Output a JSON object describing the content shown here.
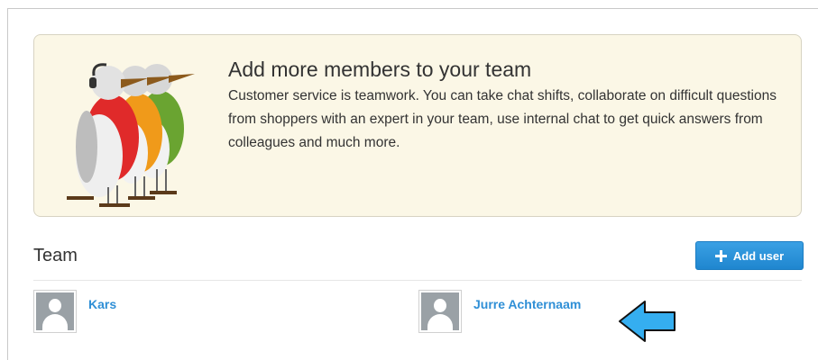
{
  "banner": {
    "title": "Add more members to your team",
    "text": "Customer service is teamwork. You can take chat shifts, collaborate on difficult questions from shoppers with an expert in your team, use internal chat to get quick answers from colleagues and much more."
  },
  "team": {
    "title": "Team",
    "add_button_label": "Add user",
    "members": [
      {
        "name": "Kars"
      },
      {
        "name": "Jurre Achternaam"
      }
    ]
  },
  "colors": {
    "accent": "#1f86cf",
    "banner_bg": "#fbf7e6",
    "link": "#2f8fd6",
    "arrow": "#35aef0"
  },
  "icons": [
    "birds-illustration",
    "plus-icon",
    "avatar-placeholder-icon",
    "arrow-left-icon"
  ]
}
